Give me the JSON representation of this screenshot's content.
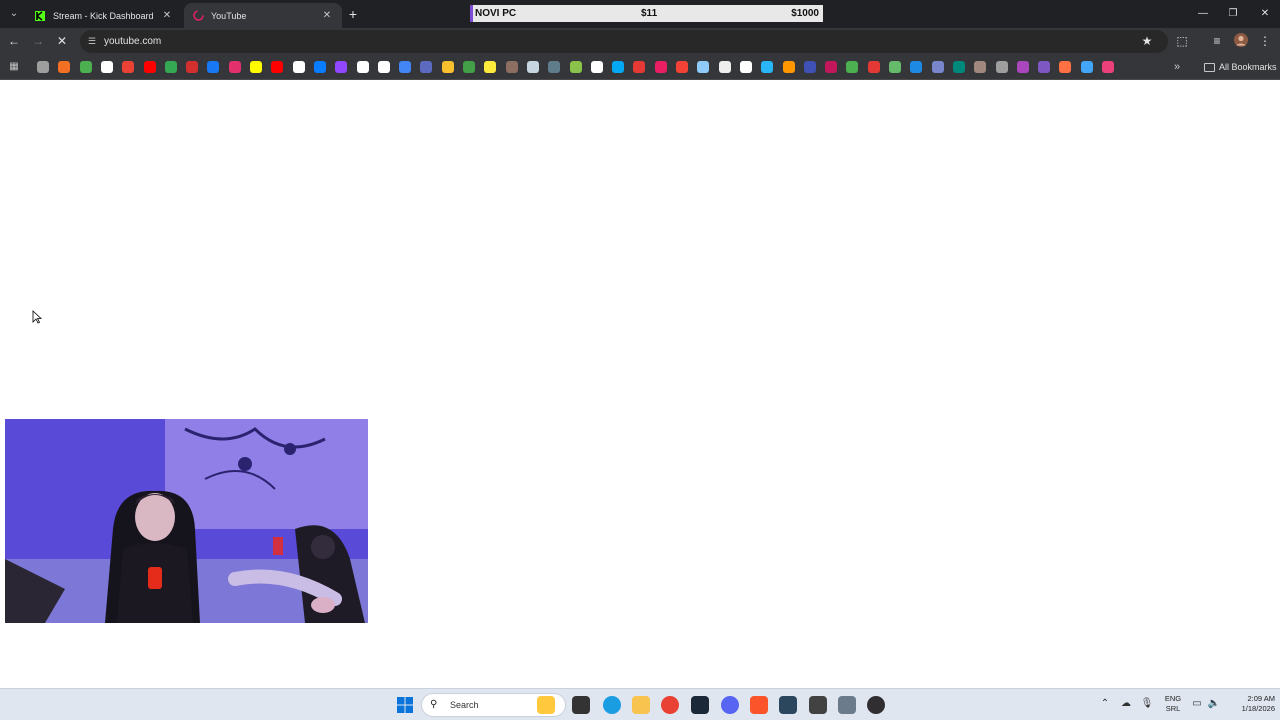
{
  "tabs": [
    {
      "title": "Stream - Kick Dashboard",
      "favicon": "kick-icon",
      "active": false
    },
    {
      "title": "YouTube",
      "favicon": "youtube-icon",
      "active": true
    }
  ],
  "stream_overlay": {
    "label": "NOVI PC",
    "current": "$11",
    "goal": "$1000"
  },
  "address_bar": {
    "url": "youtube.com"
  },
  "bookmarks": {
    "all_label": "All Bookmarks",
    "items": [
      {
        "icon": "apple-icon",
        "color": "#9e9e9e"
      },
      {
        "icon": "soundcloud-icon",
        "color": "#f26f23"
      },
      {
        "icon": "bookmark-icon",
        "color": "#4caf50"
      },
      {
        "icon": "google-icon",
        "color": "#ffffff"
      },
      {
        "icon": "gmail-icon",
        "color": "#ea4335"
      },
      {
        "icon": "youtube-icon",
        "color": "#ff0000"
      },
      {
        "icon": "maps-icon",
        "color": "#34a853"
      },
      {
        "icon": "bookmark-icon",
        "color": "#d32f2f"
      },
      {
        "icon": "facebook-icon",
        "color": "#1877f2"
      },
      {
        "icon": "instagram-icon",
        "color": "#e1306c"
      },
      {
        "icon": "snapchat-icon",
        "color": "#fffc00"
      },
      {
        "icon": "youtube-music-icon",
        "color": "#ff0000"
      },
      {
        "icon": "tiktok-icon",
        "color": "#ffffff"
      },
      {
        "icon": "messenger-icon",
        "color": "#0a7cff"
      },
      {
        "icon": "twitch-icon",
        "color": "#9146ff"
      },
      {
        "icon": "github-icon",
        "color": "#ffffff"
      },
      {
        "icon": "x-icon",
        "color": "#ffffff"
      },
      {
        "icon": "translate-icon",
        "color": "#4285f4"
      },
      {
        "icon": "bookmark-icon",
        "color": "#5c6bc0"
      },
      {
        "icon": "bookmark-icon",
        "color": "#fbc02d"
      },
      {
        "icon": "bookmark-icon",
        "color": "#43a047"
      },
      {
        "icon": "bookmark-icon",
        "color": "#ffeb3b"
      },
      {
        "icon": "bookmark-icon",
        "color": "#8d6e63"
      },
      {
        "icon": "steam-icon",
        "color": "#c7d5e0"
      },
      {
        "icon": "bookmark-icon",
        "color": "#607d8b"
      },
      {
        "icon": "bookmark-icon",
        "color": "#8bc34a"
      },
      {
        "icon": "wikipedia-icon",
        "color": "#ffffff"
      },
      {
        "icon": "bookmark-icon",
        "color": "#03a9f4"
      },
      {
        "icon": "mail-icon",
        "color": "#e53935"
      },
      {
        "icon": "bookmark-icon",
        "color": "#e91e63"
      },
      {
        "icon": "bookmark-icon",
        "color": "#f44336"
      },
      {
        "icon": "bookmark-icon",
        "color": "#90caf9"
      },
      {
        "icon": "bookmark-icon",
        "color": "#eeeeee"
      },
      {
        "icon": "bookmark-icon",
        "color": "#ffffff"
      },
      {
        "icon": "bookmark-icon",
        "color": "#29b6f6"
      },
      {
        "icon": "bookmark-icon",
        "color": "#ff9800"
      },
      {
        "icon": "bookmark-icon",
        "color": "#3f51b5"
      },
      {
        "icon": "bookmark-icon",
        "color": "#c2185b"
      },
      {
        "icon": "bookmark-icon",
        "color": "#4caf50"
      },
      {
        "icon": "bookmark-icon",
        "color": "#e53935"
      },
      {
        "icon": "bookmark-icon",
        "color": "#66bb6a"
      },
      {
        "icon": "bookmark-icon",
        "color": "#1e88e5"
      },
      {
        "icon": "bookmark-icon",
        "color": "#7986cb"
      },
      {
        "icon": "bookmark-icon",
        "color": "#00897b"
      },
      {
        "icon": "bookmark-icon",
        "color": "#a1887f"
      },
      {
        "icon": "bookmark-icon",
        "color": "#9e9e9e"
      },
      {
        "icon": "bookmark-icon",
        "color": "#ab47bc"
      },
      {
        "icon": "bookmark-icon",
        "color": "#7e57c2"
      },
      {
        "icon": "bookmark-icon",
        "color": "#ff7043"
      },
      {
        "icon": "bookmark-icon",
        "color": "#42a5f5"
      },
      {
        "icon": "bookmark-icon",
        "color": "#ec407a"
      }
    ]
  },
  "taskbar": {
    "search_label": "Search",
    "apps": [
      {
        "icon": "file-explorer-icon",
        "color": "#ffc83d"
      },
      {
        "icon": "terminal-icon",
        "color": "#333333"
      },
      {
        "icon": "edge-icon",
        "color": "#1b9de2"
      },
      {
        "icon": "folder-icon",
        "color": "#f8c44f"
      },
      {
        "icon": "chrome-icon",
        "color": "#e94235"
      },
      {
        "icon": "steam-icon",
        "color": "#1b2838"
      },
      {
        "icon": "discord-icon",
        "color": "#5865f2"
      },
      {
        "icon": "brave-icon",
        "color": "#fb542b"
      },
      {
        "icon": "steam-icon",
        "color": "#2a475e"
      },
      {
        "icon": "app-icon",
        "color": "#424242"
      },
      {
        "icon": "settings-icon",
        "color": "#6b7b8c"
      },
      {
        "icon": "obs-icon",
        "color": "#302e31"
      }
    ],
    "language": [
      "ENG",
      "SRL"
    ],
    "time": "2:09 AM",
    "date": "1/18/2026"
  }
}
